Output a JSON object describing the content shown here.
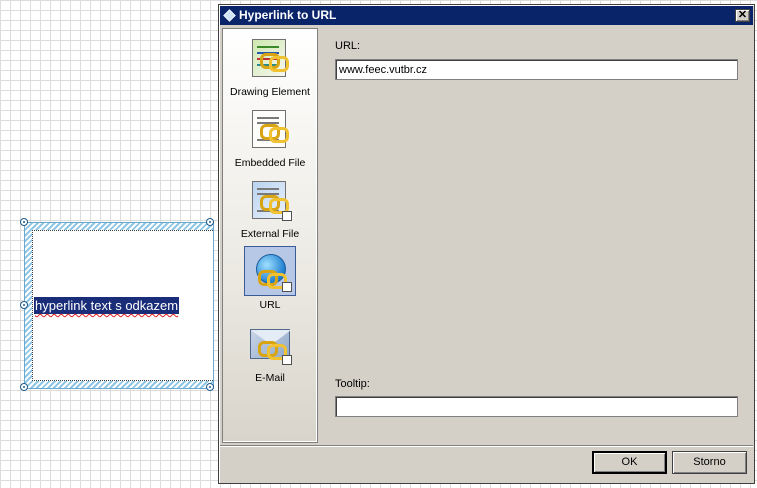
{
  "canvas": {
    "text_element": "hyperlink text s odkazem"
  },
  "dialog": {
    "title": "Hyperlink to URL",
    "close_glyph": "✕",
    "title_icon": "hyperlink-globe-icon",
    "sidebar": {
      "items": [
        {
          "label": "Drawing Element",
          "icon": "drawing-element-icon",
          "selected": false
        },
        {
          "label": "Embedded File",
          "icon": "embedded-file-icon",
          "selected": false
        },
        {
          "label": "External File",
          "icon": "external-file-icon",
          "selected": false
        },
        {
          "label": "URL",
          "icon": "url-globe-icon",
          "selected": true
        },
        {
          "label": "E-Mail",
          "icon": "email-envelope-icon",
          "selected": false
        }
      ]
    },
    "url": {
      "label": "URL:",
      "value": "www.feec.vutbr.cz"
    },
    "tooltip": {
      "label": "Tooltip:",
      "value": ""
    },
    "buttons": {
      "ok": "OK",
      "cancel": "Storno"
    }
  }
}
